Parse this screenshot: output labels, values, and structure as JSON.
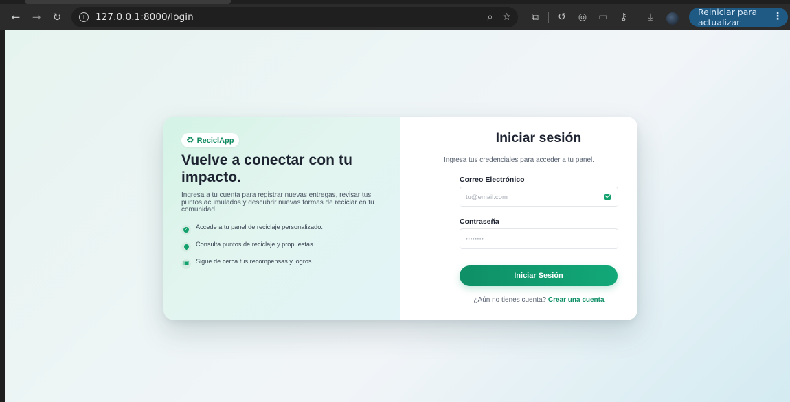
{
  "browser": {
    "url": "127.0.0.1:8000/login",
    "update_button": "Reiniciar para actualizar",
    "menu_glyph": "⋮",
    "icons": [
      "back-arrow-icon",
      "forward-arrow-icon",
      "reload-icon",
      "site-info-icon",
      "zoom-icon",
      "bookmark-star-icon",
      "extensions-puzzle-icon",
      "history-icon",
      "google-lens-icon",
      "cast-icon",
      "password-key-icon",
      "download-icon",
      "profile-avatar"
    ]
  },
  "hero": {
    "brand": "ReciclApp",
    "headline": "Vuelve a conectar con tu impacto.",
    "lead": "Ingresa a tu cuenta para registrar nuevas entregas, revisar tus puntos acumulados y descubrir nuevas formas de reciclar en tu comunidad.",
    "features": [
      {
        "text": "Accede a tu panel de reciclaje personalizado.",
        "icon": "check-circle-icon"
      },
      {
        "text": "Consulta puntos de reciclaje y propuestas.",
        "icon": "map-pin-icon"
      },
      {
        "text": "Sigue de cerca tus recompensas y logros.",
        "icon": "gift-icon"
      }
    ]
  },
  "login": {
    "title": "Iniciar sesión",
    "subtitle": "Ingresa tus credenciales para acceder a tu panel.",
    "email_label": "Correo Electrónico",
    "email_placeholder": "tu@email.com",
    "password_label": "Contraseña",
    "password_mask": "••••••••",
    "submit_label": "Iniciar Sesión",
    "signup_prompt": "¿Aún no tienes cuenta?",
    "signup_link": "Crear una cuenta"
  },
  "colors": {
    "accent": "#12a06d",
    "accent_dark": "#0f8f66",
    "text_dark": "#1d2330",
    "update_button_bg": "#1f5a85"
  }
}
